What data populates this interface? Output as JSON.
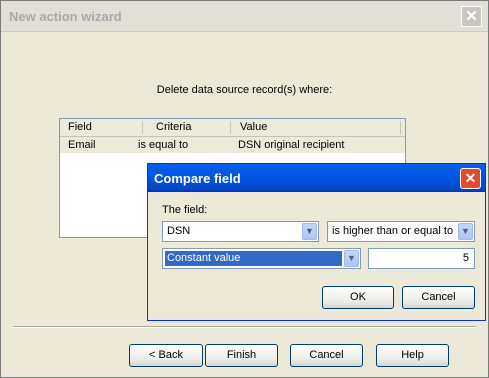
{
  "wizard": {
    "title": "New action wizard",
    "close_glyph": "✕",
    "instruction": "Delete data source record(s) where:",
    "columns": [
      "Field",
      "Criteria",
      "Value"
    ],
    "rows": [
      {
        "field": "Email",
        "criteria": "is equal to",
        "value": "DSN original recipient"
      }
    ],
    "buttons": {
      "back": "< Back",
      "finish": "Finish",
      "cancel": "Cancel",
      "help": "Help"
    }
  },
  "dialog": {
    "title": "Compare field",
    "close_glyph": "✕",
    "field_label": "The field:",
    "field_value": "DSN",
    "operator_value": "is higher than or equal to",
    "source_value": "Constant value",
    "constant": "5",
    "buttons": {
      "ok": "OK",
      "cancel": "Cancel"
    }
  },
  "icons": {
    "dropdown": "chevron-down-icon",
    "close": "close-icon"
  },
  "colors": {
    "dialog_title": "#0058e6",
    "selection": "#316ac5",
    "window_bg": "#ece9d8"
  }
}
